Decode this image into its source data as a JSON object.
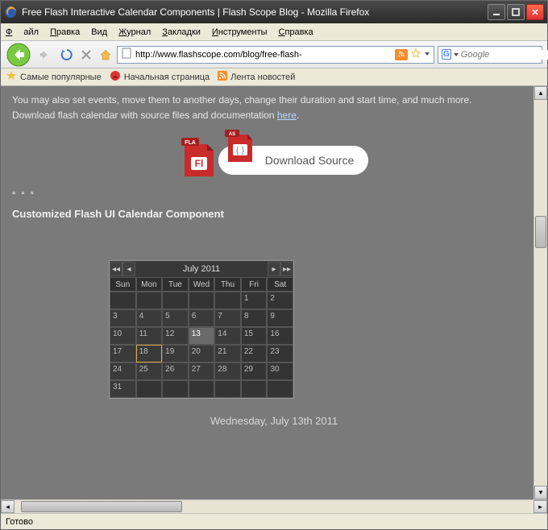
{
  "window": {
    "title": "Free Flash Interactive Calendar Components | Flash Scope Blog - Mozilla Firefox"
  },
  "menubar": {
    "file": "Файл",
    "edit": "Правка",
    "view": "Вид",
    "history": "Журнал",
    "bookmarks": "Закладки",
    "tools": "Инструменты",
    "help": "Справка"
  },
  "toolbar": {
    "url": "http://www.flashscope.com/blog/free-flash-",
    "search_placeholder": "Google"
  },
  "bookmarks": {
    "popular": "Самые популярные",
    "homepage": "Начальная страница",
    "news": "Лента новостей"
  },
  "content": {
    "line1": "You may also set events, move them to another days, change their duration and start time, and much more.",
    "line2_pre": "Download flash calendar with source files and documentation ",
    "line2_link": "here",
    "line2_post": ".",
    "download_label": "Download Source",
    "fla_tag": "FLA",
    "as_tag": "AS",
    "divider": "* * *",
    "section_heading": "Customized Flash UI Calendar Component",
    "calendar": {
      "month_year": "July  2011",
      "dow": [
        "Sun",
        "Mon",
        "Tue",
        "Wed",
        "Thu",
        "Fri",
        "Sat"
      ],
      "leading_empty": 5,
      "days": 31,
      "today": 13,
      "selected": 18
    },
    "date_caption": "Wednesday, July 13th 2011"
  },
  "statusbar": {
    "text": "Готово"
  }
}
